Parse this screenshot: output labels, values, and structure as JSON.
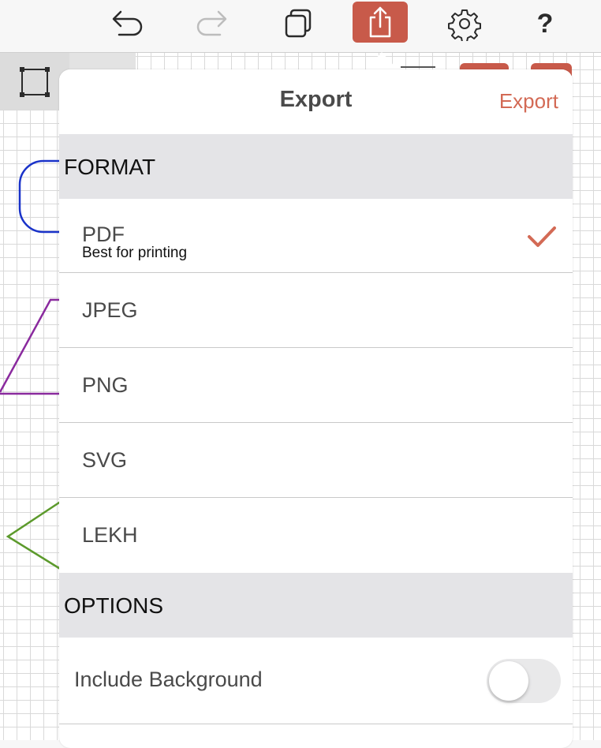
{
  "toolbar": {
    "undo_icon": "undo-icon",
    "redo_icon": "redo-icon",
    "duplicate_icon": "duplicate-icon",
    "share_icon": "share-icon",
    "settings_icon": "gear-icon",
    "help_label": "?",
    "accent_color": "#c85a4a"
  },
  "popover": {
    "title": "Export",
    "action_label": "Export",
    "format_section": "FORMAT",
    "formats": [
      {
        "label": "PDF",
        "subtitle": "Best for printing",
        "selected": true
      },
      {
        "label": "JPEG",
        "selected": false
      },
      {
        "label": "PNG",
        "selected": false
      },
      {
        "label": "SVG",
        "selected": false
      },
      {
        "label": "LEKH",
        "selected": false
      }
    ],
    "options_section": "OPTIONS",
    "options": [
      {
        "label": "Include Background",
        "enabled": false
      }
    ]
  }
}
